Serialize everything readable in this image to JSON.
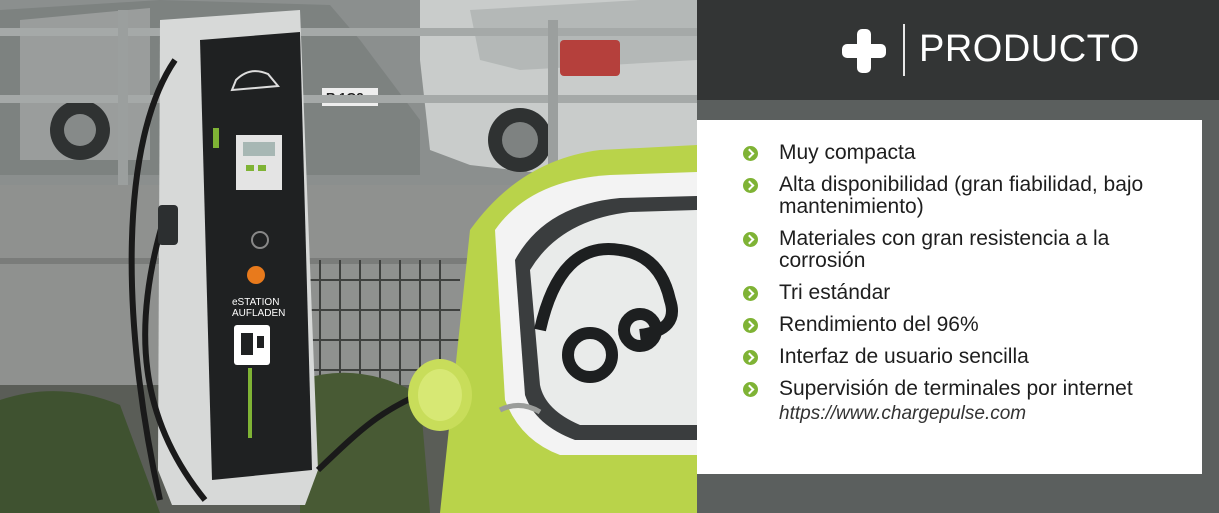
{
  "header": {
    "title": "PRODUCTO",
    "icon": "plus-icon"
  },
  "features": [
    "Muy compacta",
    "Alta disponibilidad (gran fiabilidad, bajo mantenimiento)",
    "Materiales con gran resistencia a la corrosión",
    "Tri estándar",
    "Rendimiento del 96%",
    "Interfaz de usuario sencilla",
    "Supervisión de terminales por internet"
  ],
  "url": "https://www.chargepulse.com",
  "photo": {
    "license_plate": "R 1G2",
    "station_label_1": "eSTATION",
    "station_label_2": "AUFLADEN"
  },
  "colors": {
    "accent": "#7fb335",
    "header_bg": "#333535",
    "car_green": "#b9d34a"
  }
}
